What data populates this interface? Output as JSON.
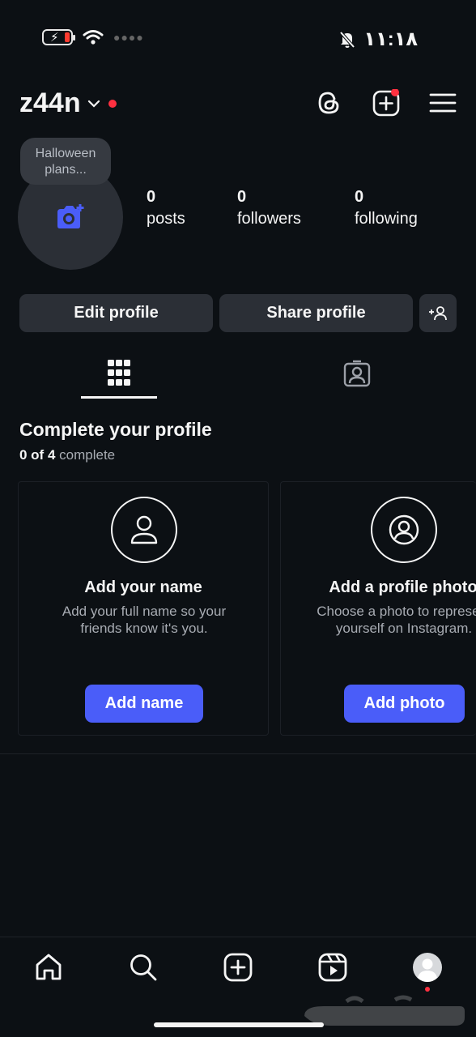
{
  "status_bar": {
    "time": "١١:١٨",
    "battery_state": "low-charging"
  },
  "header": {
    "username": "z44n",
    "icons": [
      "threads-icon",
      "create-icon",
      "menu-icon"
    ]
  },
  "profile": {
    "note": "Halloween plans...",
    "stats": [
      {
        "value": "0",
        "label": "posts"
      },
      {
        "value": "0",
        "label": "followers"
      },
      {
        "value": "0",
        "label": "following"
      }
    ]
  },
  "actions": {
    "edit_profile": "Edit profile",
    "share_profile": "Share profile"
  },
  "tabs": [
    {
      "name": "grid",
      "active": true
    },
    {
      "name": "tagged",
      "active": false
    }
  ],
  "complete_profile": {
    "title": "Complete your profile",
    "progress_count": "0 of 4",
    "progress_word": "complete",
    "cards": [
      {
        "title": "Add your name",
        "desc_line1": "Add your full name so your",
        "desc_line2": "friends know it's you.",
        "button": "Add name"
      },
      {
        "title": "Add a profile photo",
        "desc_line1": "Choose a photo to represent",
        "desc_line2": "yourself on Instagram.",
        "button": "Add photo"
      }
    ]
  },
  "bottom_nav": [
    "home-icon",
    "search-icon",
    "create-icon",
    "reels-icon",
    "profile-avatar"
  ],
  "colors": {
    "background": "#0c1014",
    "button": "#2b2f36",
    "accent": "#4a5df9",
    "notification": "#ff3040"
  }
}
